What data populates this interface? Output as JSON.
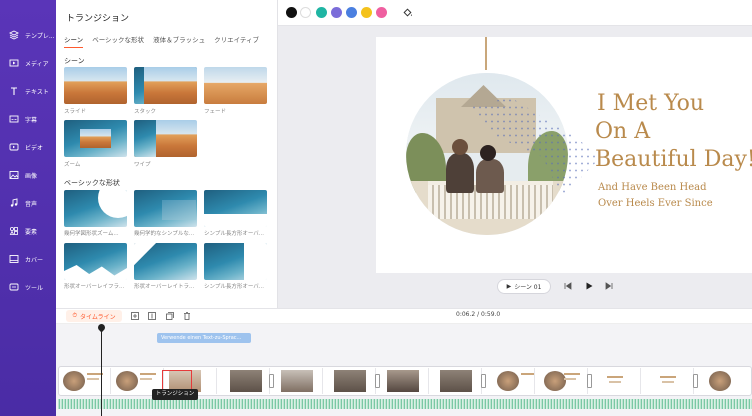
{
  "sidebar": {
    "items": [
      {
        "label": "テンプレ...",
        "icon": "layers-icon"
      },
      {
        "label": "メディア",
        "icon": "media-icon"
      },
      {
        "label": "テキスト",
        "icon": "text-icon"
      },
      {
        "label": "字幕",
        "icon": "subtitle-icon"
      },
      {
        "label": "ビデオ",
        "icon": "video-icon"
      },
      {
        "label": "画像",
        "icon": "image-icon"
      },
      {
        "label": "音声",
        "icon": "music-icon"
      },
      {
        "label": "要素",
        "icon": "elements-icon"
      },
      {
        "label": "カバー",
        "icon": "cover-icon"
      },
      {
        "label": "ツール",
        "icon": "tool-icon"
      }
    ]
  },
  "panel": {
    "title": "トランジション",
    "tabs": [
      "シーン",
      "ベーシックな形状",
      "液体＆ブラッシュ",
      "クリエイティブ"
    ],
    "section_scene": "シーン",
    "scene_items": [
      "スライド",
      "スタック",
      "フェード",
      "ズーム",
      "ワイプ"
    ],
    "section_basic": "ベーシックな形状",
    "basic_items": [
      "幾何学図形状ズーム...",
      "幾何学的なシンプルな...",
      "シンプル長方形オーバ...",
      "形状オーバーレイフラ...",
      "形状オーバーレイトラ...",
      "シンプル長方形オーバ..."
    ]
  },
  "toolbar": {
    "colors": [
      "#111111",
      "#ffffff",
      "#1fb5a3",
      "#7b6cd9",
      "#4a7fe0",
      "#f4c21c",
      "#ef5fa0"
    ]
  },
  "slide": {
    "line1": "I Met You",
    "line2": "On A",
    "line3": "Beautiful Day!",
    "sub1": "And Have Been Head",
    "sub2": "Over Heels Ever Since"
  },
  "player": {
    "scene_label": "シーン 01"
  },
  "timeline": {
    "button_label": "タイムライン",
    "time": "0:06.2 / 0:59.0",
    "text_track": "Verwende einen Text-zu-Sprac...",
    "tooltip": "トランジション"
  }
}
